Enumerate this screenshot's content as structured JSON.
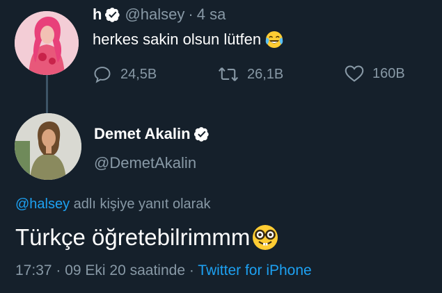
{
  "tweet1": {
    "name": "h",
    "handle": "@halsey",
    "separator": "·",
    "time": "4 sa",
    "text": "herkes sakin olsun lütfen",
    "emoji": "face-with-tears-of-joy",
    "reply_count": "24,5B",
    "retweet_count": "26,1B",
    "like_count": "160B"
  },
  "tweet2": {
    "name": "Demet Akalin",
    "handle": "@DemetAkalin",
    "reply_to_mention": "@halsey",
    "reply_to_suffix": " adlı kişiye yanıt olarak",
    "text": "Türkçe öğretebilrimmm",
    "emoji": "nerd-face",
    "timestamp": "17:37 · 09 Eki 20 saatinde · ",
    "source": "Twitter for iPhone"
  },
  "colors": {
    "background": "#15202b",
    "secondary_text": "#8899a6",
    "link": "#1da1f2",
    "verified_badge": "#ffffff"
  }
}
